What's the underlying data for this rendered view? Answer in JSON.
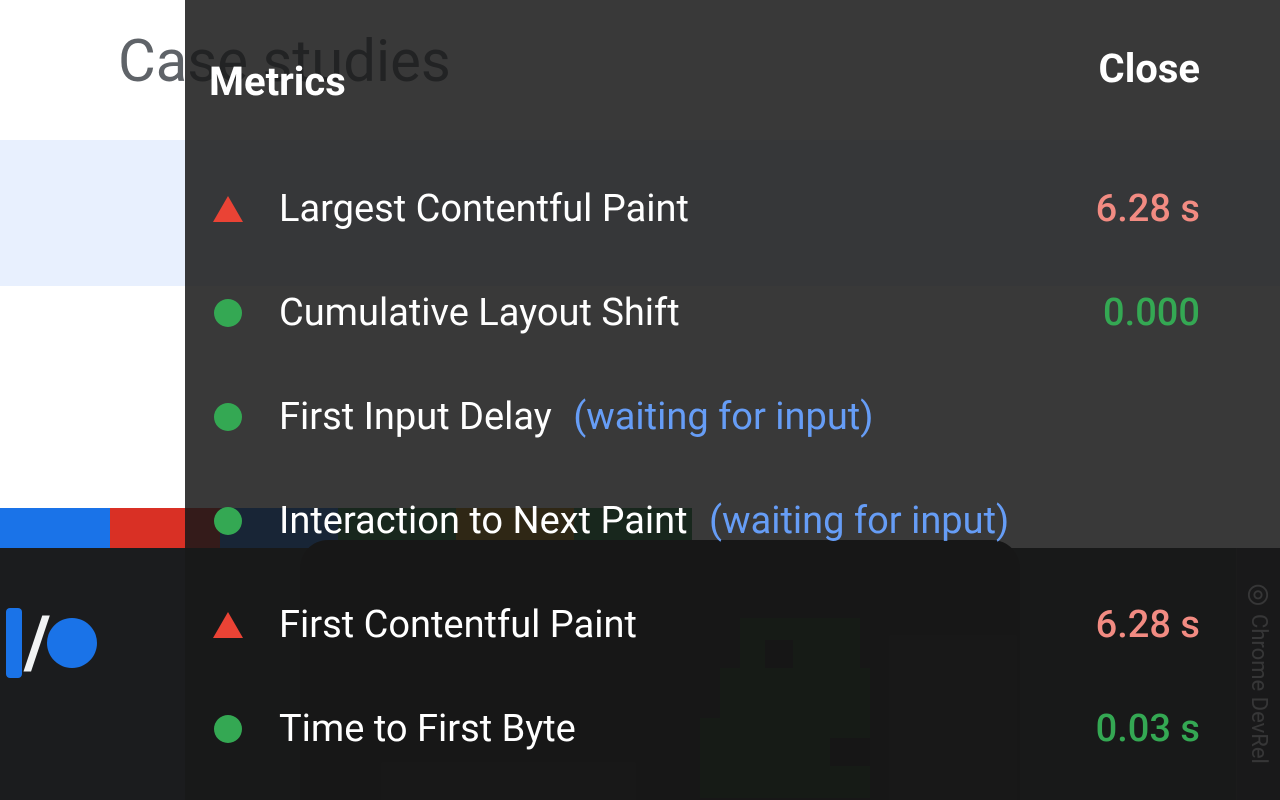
{
  "background": {
    "title": "Case studies",
    "devrel_label": "Chrome DevRel"
  },
  "overlay": {
    "title": "Metrics",
    "close": "Close",
    "metrics": [
      {
        "status": "bad",
        "label": "Largest Contentful Paint",
        "note": "",
        "value": "6.28 s",
        "valcls": "bad"
      },
      {
        "status": "good",
        "label": "Cumulative Layout Shift",
        "note": "",
        "value": "0.000",
        "valcls": "good"
      },
      {
        "status": "good",
        "label": "First Input Delay",
        "note": "(waiting for input)",
        "value": "",
        "valcls": ""
      },
      {
        "status": "good",
        "label": "Interaction to Next Paint",
        "note": "(waiting for input)",
        "value": "",
        "valcls": ""
      },
      {
        "status": "bad",
        "label": "First Contentful Paint",
        "note": "",
        "value": "6.28 s",
        "valcls": "bad"
      },
      {
        "status": "good",
        "label": "Time to First Byte",
        "note": "",
        "value": "0.03 s",
        "valcls": "good"
      }
    ]
  }
}
